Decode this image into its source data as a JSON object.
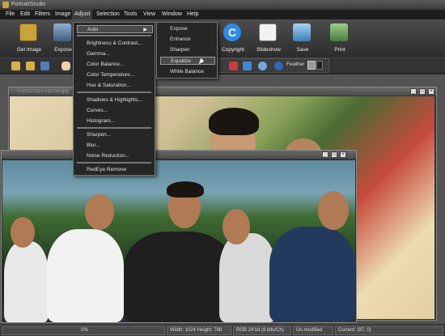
{
  "app": {
    "title": "PortraitStudio"
  },
  "menubar": [
    "File",
    "Edit",
    "Filters",
    "Image",
    "Adjust",
    "Selection",
    "Tools",
    "View",
    "Window",
    "Help"
  ],
  "ribbon": {
    "buttons": [
      {
        "label": "Get Image",
        "color": "#c9a23c"
      },
      {
        "label": "Expose",
        "color": "#7a9cc2"
      },
      {
        "label": "Copyright",
        "color": "#2e8be6"
      },
      {
        "label": "Slideshow",
        "color": "#bbbbbb"
      },
      {
        "label": "Save",
        "color": "#6fb3e8"
      },
      {
        "label": "Print",
        "color": "#77a86a"
      }
    ]
  },
  "toolbar2": {
    "feather_label": "Feather"
  },
  "adjust_menu": {
    "items": [
      {
        "label": "Auto",
        "has_submenu": true,
        "selected": true
      },
      {
        "label": "Brightness & Contrast..."
      },
      {
        "label": "Gamma..."
      },
      {
        "label": "Color Balance..."
      },
      {
        "label": "Color Temperature..."
      },
      {
        "label": "Hue & Saturation..."
      },
      {
        "label": "Shadows & Highlights..."
      },
      {
        "label": "Curves..."
      },
      {
        "label": "Histogram..."
      },
      {
        "label": "Sharpen..."
      },
      {
        "label": "Blur..."
      },
      {
        "label": "Noise Reduction..."
      },
      {
        "label": "RedEye Remove"
      }
    ]
  },
  "auto_submenu": {
    "items": [
      {
        "label": "Expose"
      },
      {
        "label": "Enhance"
      },
      {
        "label": "Sharpen"
      },
      {
        "label": "Equalize",
        "selected": true
      },
      {
        "label": "White Balance"
      }
    ]
  },
  "back_window": {
    "title": "c:\\20121112-211750.jpg"
  },
  "statusbar": {
    "zoom": "0%",
    "dimensions": "Width: 1024  Height: 768",
    "color_mode": "RGB 24 bit (8 bits/Ch)",
    "modified": "Un-modified",
    "current": "Current: (87, 0)"
  }
}
